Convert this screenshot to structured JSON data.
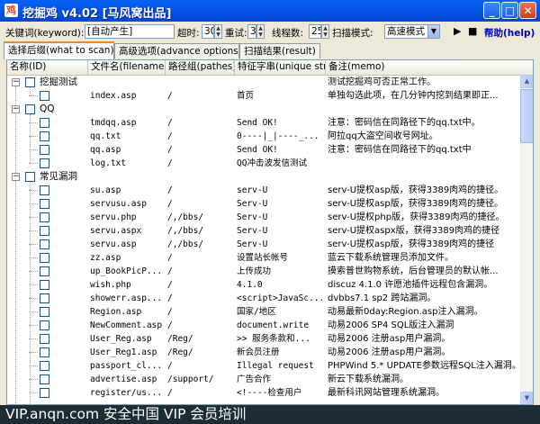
{
  "window": {
    "title": "挖掘鸡 v4.02 [马风窝出品]",
    "buttons": {
      "minimize": "_",
      "maximize": "□",
      "close": "✕"
    }
  },
  "toolbar": {
    "keyword_label": "关键词(keyword):",
    "keyword_value": "[自动产生]",
    "timeout_label": "超时:",
    "timeout_value": "30",
    "retry_label": "重试:",
    "retry_value": "3",
    "threads_label": "线程数:",
    "threads_value": "25",
    "scanmode_label": "扫描模式:",
    "scanmode_value": "高速模式",
    "play_glyph": "▶",
    "stop_glyph": "■",
    "help_label": "帮助(help)"
  },
  "tabs": [
    {
      "label": "选择后缀(what to scan)"
    },
    {
      "label": "高级选项(advance options)"
    },
    {
      "label": "扫描结果(result)"
    }
  ],
  "columns": [
    "名称(ID)",
    "文件名(filename)",
    "路径组(pathes)",
    "特征字串(unique str)",
    "备注(memo)"
  ],
  "groups": [
    {
      "label": "挖掘测试",
      "memo": "测试挖掘鸡可否正常工作。"
    },
    {
      "label": "QQ",
      "memo": ""
    },
    {
      "label": "常见漏洞",
      "memo": ""
    }
  ],
  "rows": [
    {
      "filename": "index.asp",
      "path": "/",
      "unique": "首页",
      "memo": "单独勾选此项，在几分钟内挖到结果即正..."
    },
    {
      "filename": "tmdqq.asp",
      "path": "/",
      "unique": "Send OK!",
      "memo": "注意：密码信在同路径下的qq.txt中。"
    },
    {
      "filename": "qq.txt",
      "path": "/",
      "unique": "0----|_|----_...",
      "memo": "阿拉qq大盗空间收号网址。"
    },
    {
      "filename": "qq.asp",
      "path": "/",
      "unique": "Send OK!",
      "memo": "注意：密码信在同路径下的qq.txt中"
    },
    {
      "filename": "log.txt",
      "path": "/",
      "unique": "QQ冲击波发信测试",
      "memo": ""
    },
    {
      "filename": "su.asp",
      "path": "/",
      "unique": "serv-U",
      "memo": "serv-U提权asp版，获得3389肉鸡的捷径。"
    },
    {
      "filename": "servusu.asp",
      "path": "/",
      "unique": "Serv-U",
      "memo": "serv-U提权asp版，获得3389肉鸡的捷径。"
    },
    {
      "filename": "servu.php",
      "path": "/,/bbs/",
      "unique": "Serv-U",
      "memo": "serv-U提权php版，获得3389肉鸡的捷径。"
    },
    {
      "filename": "servu.aspx",
      "path": "/,/bbs/",
      "unique": "Serv-U",
      "memo": "serv-U提权aspx版，获得3389肉鸡的捷径"
    },
    {
      "filename": "servu.asp",
      "path": "/,/bbs/",
      "unique": "Serv-U",
      "memo": "serv-U提权asp版，获得3389肉鸡的捷径"
    },
    {
      "filename": "zz.asp",
      "path": "/",
      "unique": "设置站长帐号",
      "memo": "蓝云下载系统管理员添加文件。"
    },
    {
      "filename": "up_BookPicP...",
      "path": "/",
      "unique": "上传成功",
      "memo": "摸索普世购物系统，后台管理员的默认帐..."
    },
    {
      "filename": "wish.php",
      "path": "/",
      "unique": "4.1.0",
      "memo": "discuz 4.1.0 许愿池插件远程包含漏洞。"
    },
    {
      "filename": "showerr.asp...",
      "path": "/",
      "unique": "<script>JavaSc...",
      "memo": "dvbbs7.1 sp2 跨站漏洞。"
    },
    {
      "filename": "Region.asp",
      "path": "/",
      "unique": "国家/地区",
      "memo": "动易最新0day:Region.asp注入漏洞。"
    },
    {
      "filename": "NewComment.asp",
      "path": "/",
      "unique": "document.write",
      "memo": "动易2006 SP4 SQL版注入漏洞"
    },
    {
      "filename": "User_Reg.asp",
      "path": "/Reg/",
      "unique": ">> 服务条款和...",
      "memo": "动易2006 注册asp用户漏洞。"
    },
    {
      "filename": "User_Reg1.asp",
      "path": "/Reg/",
      "unique": "新会员注册",
      "memo": "动易2006 注册asp用户漏洞。"
    },
    {
      "filename": "passport_cl...",
      "path": "/",
      "unique": "Illegal request",
      "memo": "PHPWind 5.* UPDATE参数远程SQL注入漏洞。"
    },
    {
      "filename": "advertise.asp",
      "path": "/support/",
      "unique": "广告合作",
      "memo": "新云下载系统漏洞。"
    },
    {
      "filename": "register/us...",
      "path": "/",
      "unique": "<!----检查用户",
      "memo": "最新科讯网站管理系统漏洞。"
    }
  ],
  "watermark": "VIP.anqn.com   安全中国 VIP 会员培训"
}
